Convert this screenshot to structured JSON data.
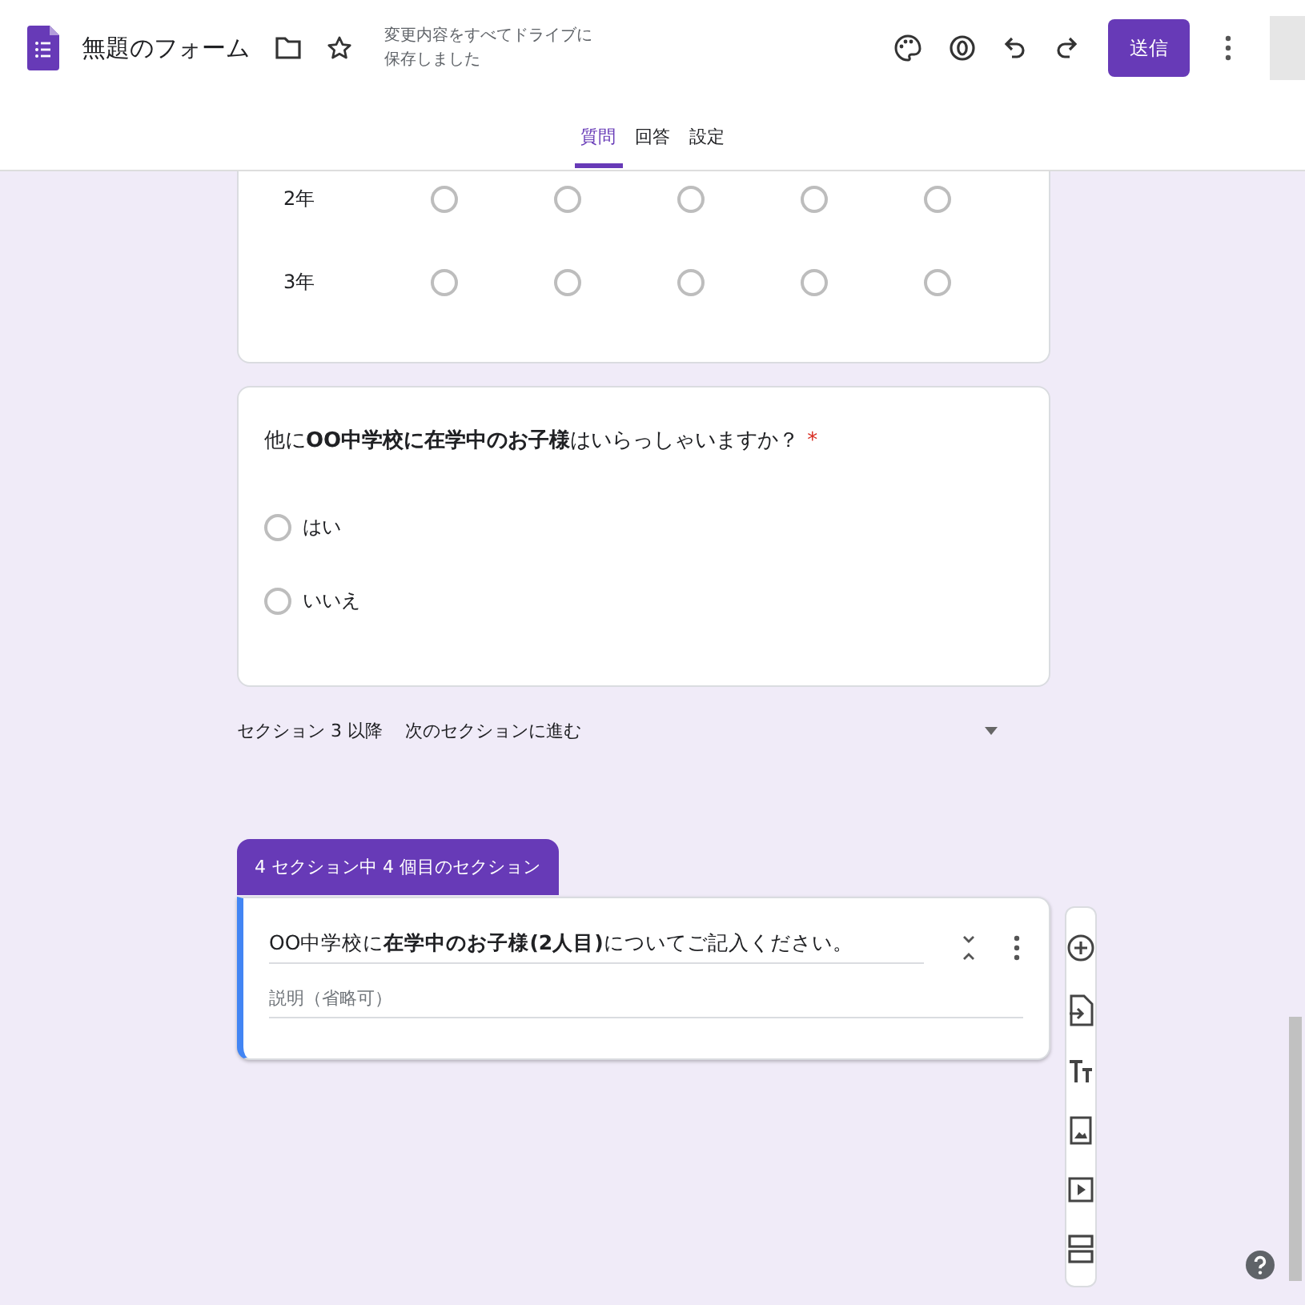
{
  "header": {
    "title": "無題のフォーム",
    "save_status": [
      "変更内容をすべてドライブに",
      "保存しました"
    ],
    "send_button": "送信"
  },
  "tabs": [
    {
      "label": "質問",
      "selected": true
    },
    {
      "label": "回答",
      "selected": false
    },
    {
      "label": "設定",
      "selected": false
    }
  ],
  "grid_question": {
    "rows": [
      {
        "label": "2年",
        "choices": [
          {
            "selected": false
          },
          {
            "selected": false
          },
          {
            "selected": false
          },
          {
            "selected": false
          },
          {
            "selected": false
          }
        ]
      },
      {
        "label": "3年",
        "choices": [
          {
            "selected": false
          },
          {
            "selected": false
          },
          {
            "selected": false
          },
          {
            "selected": false
          },
          {
            "selected": false
          }
        ]
      }
    ]
  },
  "question": {
    "text": "他に**OO中学校に在学中のお子様**はいらっしゃいますか？",
    "required": true,
    "required_mark": "*",
    "options": [
      {
        "label": "はい",
        "selected": false
      },
      {
        "label": "いいえ",
        "selected": false
      }
    ]
  },
  "section_navigation": {
    "label": "セクション 3 以降",
    "value": "次のセクションに進む"
  },
  "section": {
    "badge": "4 セクション中 4 個目のセクション",
    "title": "OO中学校に**在学中のお子様(2人目)**についてご記入ください。",
    "description": {
      "placeholder": "説明（省略可）"
    }
  }
}
